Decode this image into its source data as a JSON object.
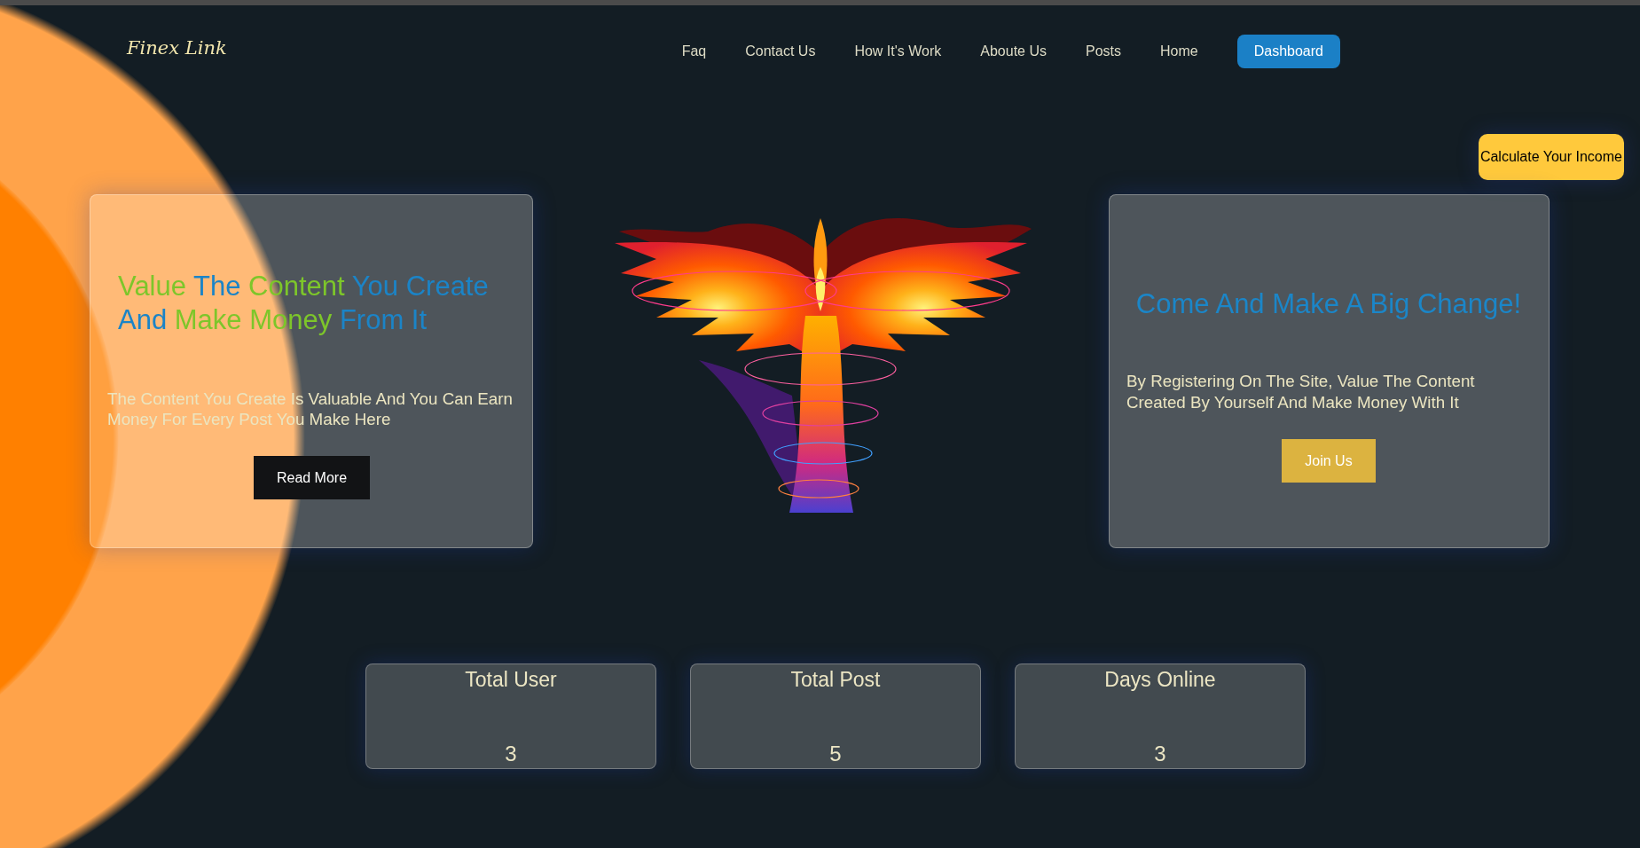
{
  "header": {
    "logo": "Finex Link",
    "nav": [
      {
        "label": "Faq"
      },
      {
        "label": "Contact Us"
      },
      {
        "label": "How It's Work"
      },
      {
        "label": "Aboute Us"
      },
      {
        "label": "Posts"
      },
      {
        "label": "Home"
      }
    ],
    "dashboard_button": "Dashboard"
  },
  "calculate_button": "Calculate Your Income",
  "intro_card": {
    "title": [
      {
        "text": "Value",
        "color": "#7dc62a"
      },
      {
        "text": "The",
        "color": "#1b84c7"
      },
      {
        "text": "Content",
        "color": "#7dc62a"
      },
      {
        "text": "You Create",
        "color": "#1b84c7"
      },
      {
        "text": "And",
        "color": "#1b84c7"
      },
      {
        "text": "Make Money",
        "color": "#7dc62a"
      },
      {
        "text": "From It",
        "color": "#1b84c7"
      }
    ],
    "text": "The Content You Create Is Valuable And You Can Earn Money For Every Post You Make Here",
    "button": "Read More"
  },
  "join_card": {
    "title": "Come And Make A Big Change!",
    "text": "By Registering On The Site, Value The Content Created By Yourself And Make Money With It",
    "button": "Join Us"
  },
  "stats": [
    {
      "label": "Total User",
      "value": "3"
    },
    {
      "label": "Total Post",
      "value": "5"
    },
    {
      "label": "Days Online",
      "value": "3"
    }
  ]
}
